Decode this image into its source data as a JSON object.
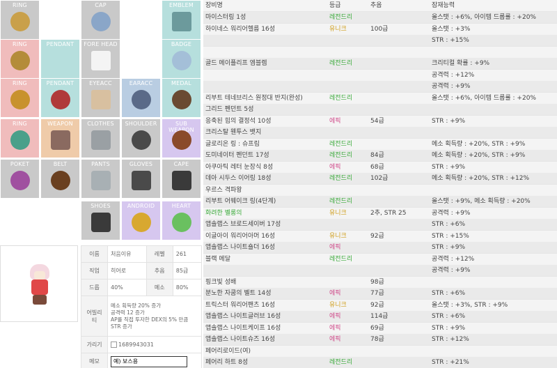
{
  "slots": {
    "ring1": "RING",
    "cap": "CAP",
    "emblem": "EMBLEM",
    "ring2": "RING",
    "pendant1": "PENDANT",
    "forehead": "FORE HEAD",
    "badge": "BADGE",
    "ring3": "RING",
    "pendant2": "PENDANT",
    "eyeacc": "EYEACC",
    "earacc": "EARACC",
    "medal": "MEDAL",
    "ring4": "RING",
    "weapon": "WEAPON",
    "clothes": "CLOTHES",
    "shoulder": "SHOULDER",
    "subweapon": "SUB WEAPON",
    "poket": "POKET",
    "belt": "BELT",
    "pants": "PANTS",
    "gloves": "GLOVES",
    "cape": "CAPE",
    "shoes": "SHOES",
    "android": "ANDROID",
    "heart": "HEART"
  },
  "info": {
    "name_label": "이름",
    "name": "처음이유",
    "level_label": "레벨",
    "level": "261",
    "job_label": "직업",
    "job": "히어로",
    "star_label": "추옵",
    "star": "85급",
    "drop_label": "드롭",
    "drop": "40%",
    "meso_label": "메소",
    "meso": "80%",
    "ability_label": "어빌리티",
    "ability1": "메소 획득량 20% 증가",
    "ability2": "공격력 12 증가",
    "ability3": "AP를 직접 투자한 DEX의 5% 만큼 STR 증가",
    "hide_label": "가리기",
    "hide_value": "1689943031",
    "memo_label": "메모",
    "memo_value": "예) 보스용"
  },
  "equip_header": {
    "name": "장비명",
    "grade": "등급",
    "star": "추옵",
    "potential": "잠재능력"
  },
  "equip_rows": [
    {
      "name": "마이스터링 1성",
      "grade": "레전드리",
      "gc": "green",
      "star": "",
      "pot": "올스탯 : +6%, 아이템 드롭률 : +20%"
    },
    {
      "name": "하이네스 워리어헬름 16성",
      "grade": "유니크",
      "gc": "gold",
      "star": "100급",
      "pot": "올스탯 : +3%"
    },
    {
      "name": "",
      "grade": "",
      "gc": "",
      "star": "",
      "pot": "STR : +15%"
    },
    {
      "name": "",
      "grade": "",
      "gc": "",
      "star": "",
      "pot": ""
    },
    {
      "name": "골드 메이플리프 엠블렘",
      "grade": "레전드리",
      "gc": "green",
      "star": "",
      "pot": "크리티컬 확률 : +9%"
    },
    {
      "name": "",
      "grade": "",
      "gc": "",
      "star": "",
      "pot": "공격력 : +12%"
    },
    {
      "name": "",
      "grade": "",
      "gc": "",
      "star": "",
      "pot": "공격력 : +9%"
    },
    {
      "name": "리부트 테네브리스 원정대 반지(완성)",
      "grade": "레전드리",
      "gc": "green",
      "star": "",
      "pot": "올스탯 : +6%, 아이템 드롭률 : +20%"
    },
    {
      "name": "그리드 펜던트 5성",
      "grade": "",
      "gc": "",
      "star": "",
      "pot": ""
    },
    {
      "name": "응축된 힘의 결정석 10성",
      "grade": "에픽",
      "gc": "red",
      "star": "54급",
      "pot": "STR : +9%"
    },
    {
      "name": "크리스탈 웬투스 뱃지",
      "grade": "",
      "gc": "",
      "star": "",
      "pot": ""
    },
    {
      "name": "글로리온 링 : 슈프림",
      "grade": "레전드리",
      "gc": "green",
      "star": "",
      "pot": "메소 획득량 : +20%, STR : +9%"
    },
    {
      "name": "도미네이터 펜던트 17성",
      "grade": "레전드리",
      "gc": "green",
      "star": "84급",
      "pot": "메소 획득량 : +20%, STR : +9%"
    },
    {
      "name": "아쿠아틱 레터 눈장식 8성",
      "grade": "에픽",
      "gc": "red",
      "star": "68급",
      "pot": "STR : +9%"
    },
    {
      "name": "데아 시두스 이어링 18성",
      "grade": "레전드리",
      "gc": "green",
      "star": "102급",
      "pot": "메소 획득량 : +20%, STR : +12%"
    },
    {
      "name": "우르스 격파왕",
      "grade": "",
      "gc": "",
      "star": "",
      "pot": ""
    },
    {
      "name": "리부트 어웨이크 링(4단계)",
      "grade": "레전드리",
      "gc": "green",
      "star": "",
      "pot": "올스탯 : +9%, 메소 획득량 : +20%"
    },
    {
      "name": "화려한 벨롱의",
      "nc": "green",
      "grade": "유니크",
      "gc": "gold",
      "star": "2추, STR 25",
      "pot": "공격력 : +9%"
    },
    {
      "name": "앱솔랩스 브로드세이버 17성",
      "grade": "",
      "gc": "",
      "star": "",
      "pot": "STR : +6%"
    },
    {
      "name": "이글아이 워리어아머 16성",
      "grade": "유니크",
      "gc": "gold",
      "star": "92급",
      "pot": "STR : +15%"
    },
    {
      "name": "앱솔랩스 나이트숄더 16성",
      "grade": "에픽",
      "gc": "red",
      "star": "",
      "pot": "STR : +9%"
    },
    {
      "name": "블랙 메달",
      "grade": "레전드리",
      "gc": "green",
      "star": "",
      "pot": "공격력 : +12%"
    },
    {
      "name": "",
      "grade": "",
      "gc": "",
      "star": "",
      "pot": "공격력 : +9%"
    },
    {
      "name": "핑크빛 성배",
      "grade": "",
      "gc": "",
      "star": "98급",
      "pot": ""
    },
    {
      "name": "분노한 자쿰의 벨트 14성",
      "grade": "에픽",
      "gc": "red",
      "star": "77급",
      "pot": "STR : +6%"
    },
    {
      "name": "트릭스터 워리어팬츠 16성",
      "grade": "유니크",
      "gc": "gold",
      "star": "92급",
      "pot": "올스탯 : +3%, STR : +9%"
    },
    {
      "name": "앱솔랩스 나이트글러브 16성",
      "grade": "에픽",
      "gc": "red",
      "star": "114급",
      "pot": "STR : +6%"
    },
    {
      "name": "앱솔랩스 나이트케이프 16성",
      "grade": "에픽",
      "gc": "red",
      "star": "69급",
      "pot": "STR : +9%"
    },
    {
      "name": "앱솔랩스 나이트슈즈 16성",
      "grade": "에픽",
      "gc": "red",
      "star": "78급",
      "pot": "STR : +12%"
    },
    {
      "name": "페어리로이드(여)",
      "grade": "",
      "gc": "",
      "star": "",
      "pot": ""
    },
    {
      "name": "페어리 하트 8성",
      "grade": "레전드리",
      "gc": "green",
      "star": "",
      "pot": "STR : +21%"
    }
  ]
}
